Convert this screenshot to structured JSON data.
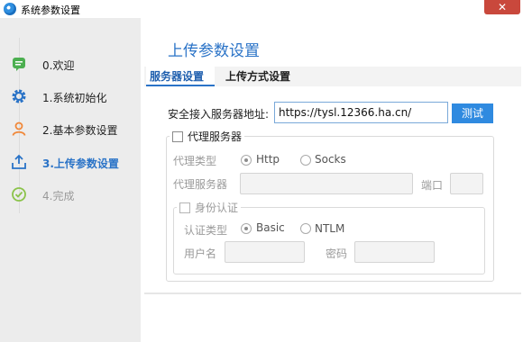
{
  "window": {
    "title": "系统参数设置",
    "close_glyph": "✕",
    "accent": "#2a73c7"
  },
  "steps": [
    {
      "label": "0.欢迎",
      "icon": "chat-icon",
      "state": "done",
      "color": "#4caf50"
    },
    {
      "label": "1.系统初始化",
      "icon": "gear-icon",
      "state": "done",
      "color": "#2a73c7"
    },
    {
      "label": "2.基本参数设置",
      "icon": "user-icon",
      "state": "done",
      "color": "#f0883a"
    },
    {
      "label": "3.上传参数设置",
      "icon": "upload-icon",
      "state": "active",
      "color": "#2a73c7"
    },
    {
      "label": "4.完成",
      "icon": "check-circle-icon",
      "state": "disabled",
      "color": "#8bc34a"
    }
  ],
  "main": {
    "title": "上传参数设置",
    "tabs": [
      {
        "label": "服务器设置",
        "active": true
      },
      {
        "label": "上传方式设置",
        "active": false
      }
    ],
    "server": {
      "label": "安全接入服务器地址:",
      "value": "https://tysl.12366.ha.cn/",
      "test_button": "测试"
    },
    "proxy": {
      "checkbox_label": "代理服务器",
      "type_label": "代理类型",
      "options": [
        "Http",
        "Socks"
      ],
      "server_label": "代理服务器",
      "port_label": "端口",
      "server_value": "",
      "port_value": ""
    },
    "auth": {
      "checkbox_label": "身份认证",
      "type_label": "认证类型",
      "options": [
        "Basic",
        "NTLM"
      ],
      "user_label": "用户名",
      "password_label": "密码",
      "user_value": "",
      "password_value": ""
    }
  }
}
